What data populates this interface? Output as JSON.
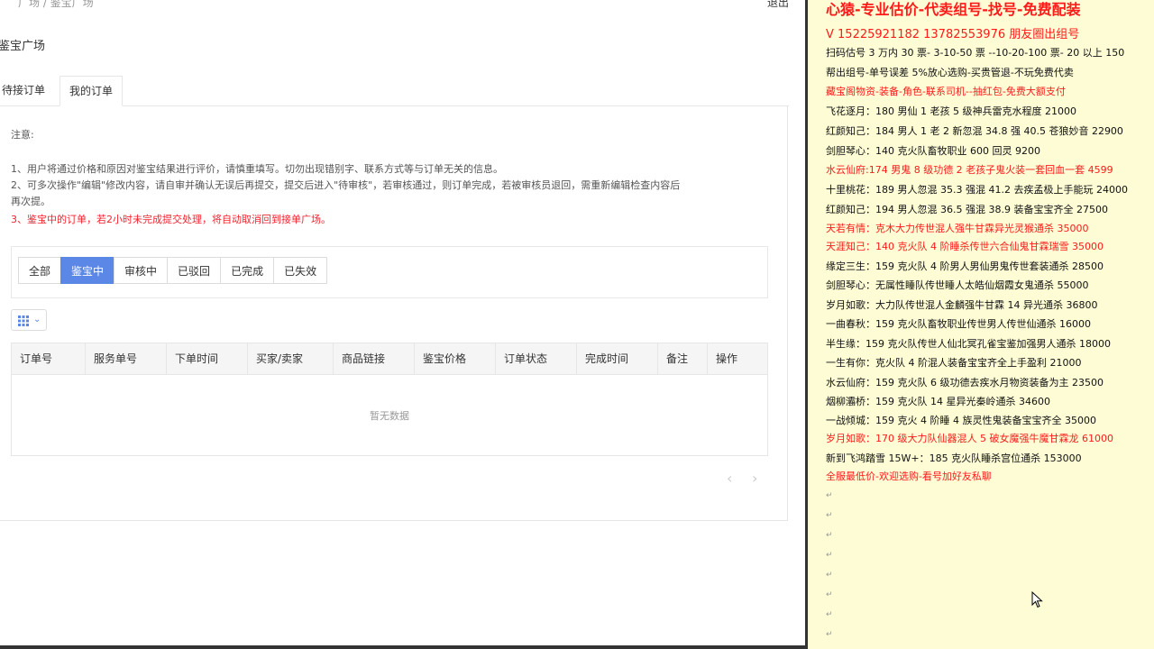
{
  "topbar": {
    "breadcrumb": "广场 / 鉴宝广场",
    "logout": "退出"
  },
  "page_title": "鉴宝广场",
  "tabs": [
    "待接订单",
    "我的订单"
  ],
  "notes": {
    "heading": "注意:",
    "lines": [
      "1、用户将通过价格和原因对鉴宝结果进行评价，请慎重填写。切勿出现错别字、联系方式等与订单无关的信息。",
      "2、可多次操作\"编辑\"修改内容，请自审并确认无误后再提交，提交后进入\"待审核\"，若审核通过，则订单完成，若被审核员退回，需重新编辑检查内容后",
      "再次提。",
      "3、鉴宝中的订单，若2小时未完成提交处理，将自动取消回到接单广场。"
    ]
  },
  "filters": [
    "全部",
    "鉴宝中",
    "审核中",
    "已驳回",
    "已完成",
    "已失效"
  ],
  "active_filter": "鉴宝中",
  "table": {
    "columns": [
      "订单号",
      "服务单号",
      "下单时间",
      "买家/卖家",
      "商品链接",
      "鉴宝价格",
      "订单状态",
      "完成时间",
      "备注",
      "操作"
    ],
    "empty_text": "暂无数据"
  },
  "pager": {
    "prev": "‹",
    "next": "›"
  },
  "ad": {
    "title": "心猿-专业估价-代卖组号-找号-免费配装",
    "phone": "V 15225921182   13782553976 朋友圈出组号",
    "lines": [
      {
        "text": "扫码估号 3 万内 30 票- 3-10-50 票  --10-20-100 票- 20 以上 150",
        "red": false
      },
      {
        "text": "帮出组号-单号误差 5%放心选购-买贵管退-不玩免费代卖",
        "red": false
      },
      {
        "text": "藏宝阁物资-装备-角色-联系司机--抽红包-免费大额支付",
        "red": true
      },
      {
        "text": "飞花逐月：180 男仙 1 老孩 5 级神兵雷克水程度 21000",
        "red": false
      },
      {
        "text": "红颜知己：184 男人 1 老 2 新忽混 34.8 强 40.5 苍狼妙音 22900",
        "red": false
      },
      {
        "text": "剑胆琴心：140 克火队畜牧职业 600 回灵 9200",
        "red": false
      },
      {
        "text": "水云仙府:174 男鬼 8 级功德 2 老孩子鬼火装一套回血一套 4599",
        "red": true
      },
      {
        "text": "十里桃花：189 男人忽混 35.3 强混 41.2 去疾孟极上手能玩 24000",
        "red": false
      },
      {
        "text": "红颜知己：194 男人忽混 36.5 强混 38.9 装备宝宝齐全 27500",
        "red": false
      },
      {
        "text": "天若有情：克木大力传世混人强牛甘霖异光灵猴通杀 35000",
        "red": true
      },
      {
        "text": "天涯知己：140 克火队 4 阶睡杀传世六合仙鬼甘霖瑞雪 35000",
        "red": true
      },
      {
        "text": "缘定三生：159 克火队 4 阶男人男仙男鬼传世套装通杀 28500",
        "red": false
      },
      {
        "text": "剑胆琴心：无属性睡队传世睡人太皓仙烟霞女鬼通杀 55000",
        "red": false
      },
      {
        "text": "岁月如歌：大力队传世混人金麟强牛甘霖 14 异光通杀 36800",
        "red": false
      },
      {
        "text": "一曲春秋：159 克火队畜牧职业传世男人传世仙通杀 16000",
        "red": false
      },
      {
        "text": "半生缘：159 克火队传世人仙北冥孔雀宝鉴加强男人通杀 18000",
        "red": false
      },
      {
        "text": "一生有你：克火队 4 阶混人装备宝宝齐全上手盈利 21000",
        "red": false
      },
      {
        "text": "水云仙府：159 克火队 6 级功德去疾水月物资装备为主 23500",
        "red": false
      },
      {
        "text": "烟柳灞桥：159 克火队 14 星异光秦岭通杀 34600",
        "red": false
      },
      {
        "text": "一战倾城：159 克火 4 阶睡 4 族灵性鬼装备宝宝齐全 35000",
        "red": false
      },
      {
        "text": "岁月如歌：170 级大力队仙器混人 5 破女魔强牛魔甘霖龙 61000",
        "red": true
      },
      {
        "text": "新到飞鸿踏雪 15W+：185 克火队睡杀宫位通杀 153000",
        "red": false
      },
      {
        "text": "全服最低价-欢迎选购-看号加好友私聊",
        "red": true
      }
    ]
  }
}
